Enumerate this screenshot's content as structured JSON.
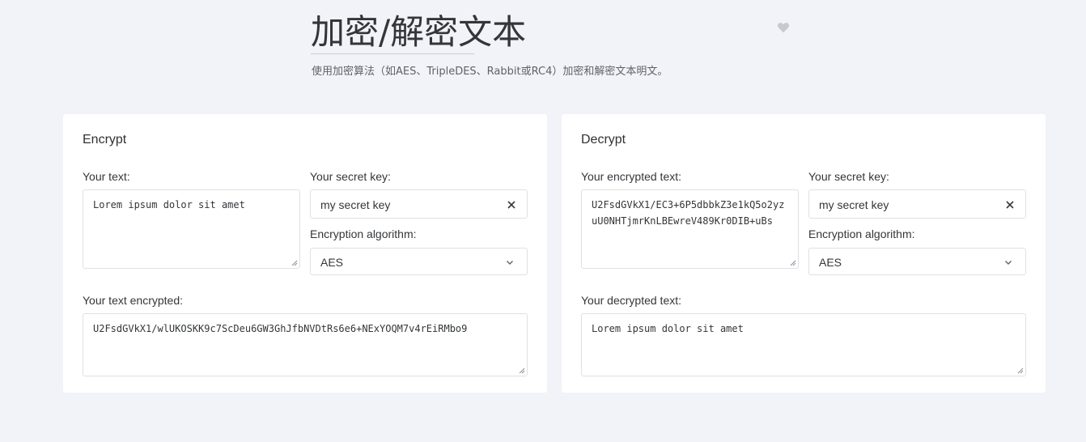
{
  "header": {
    "title": "加密/解密文本",
    "subtitle": "使用加密算法（如AES、TripleDES、Rabbit或RC4）加密和解密文本明文。",
    "favorite_icon": "heart-icon"
  },
  "encrypt": {
    "title": "Encrypt",
    "text_label": "Your text:",
    "text_value": "Lorem ipsum dolor sit amet",
    "key_label": "Your secret key:",
    "key_value": "my secret key",
    "algorithm_label": "Encryption algorithm:",
    "algorithm_value": "AES",
    "output_label": "Your text encrypted:",
    "output_value": "U2FsdGVkX1/wlUKOSKK9c7ScDeu6GW3GhJfbNVDtRs6e6+NExYOQM7v4rEiRMbo9"
  },
  "decrypt": {
    "title": "Decrypt",
    "text_label": "Your encrypted text:",
    "text_value": "U2FsdGVkX1/EC3+6P5dbbkZ3e1kQ5o2yzuU0NHTjmrKnLBEwreV489Kr0DIB+uBs",
    "key_label": "Your secret key:",
    "key_value": "my secret key",
    "algorithm_label": "Encryption algorithm:",
    "algorithm_value": "AES",
    "output_label": "Your decrypted text:",
    "output_value": "Lorem ipsum dolor sit amet"
  },
  "colors": {
    "page_background": "#f1f3f8",
    "card_background": "#ffffff",
    "border": "#e0e0e6",
    "text": "#333639"
  }
}
